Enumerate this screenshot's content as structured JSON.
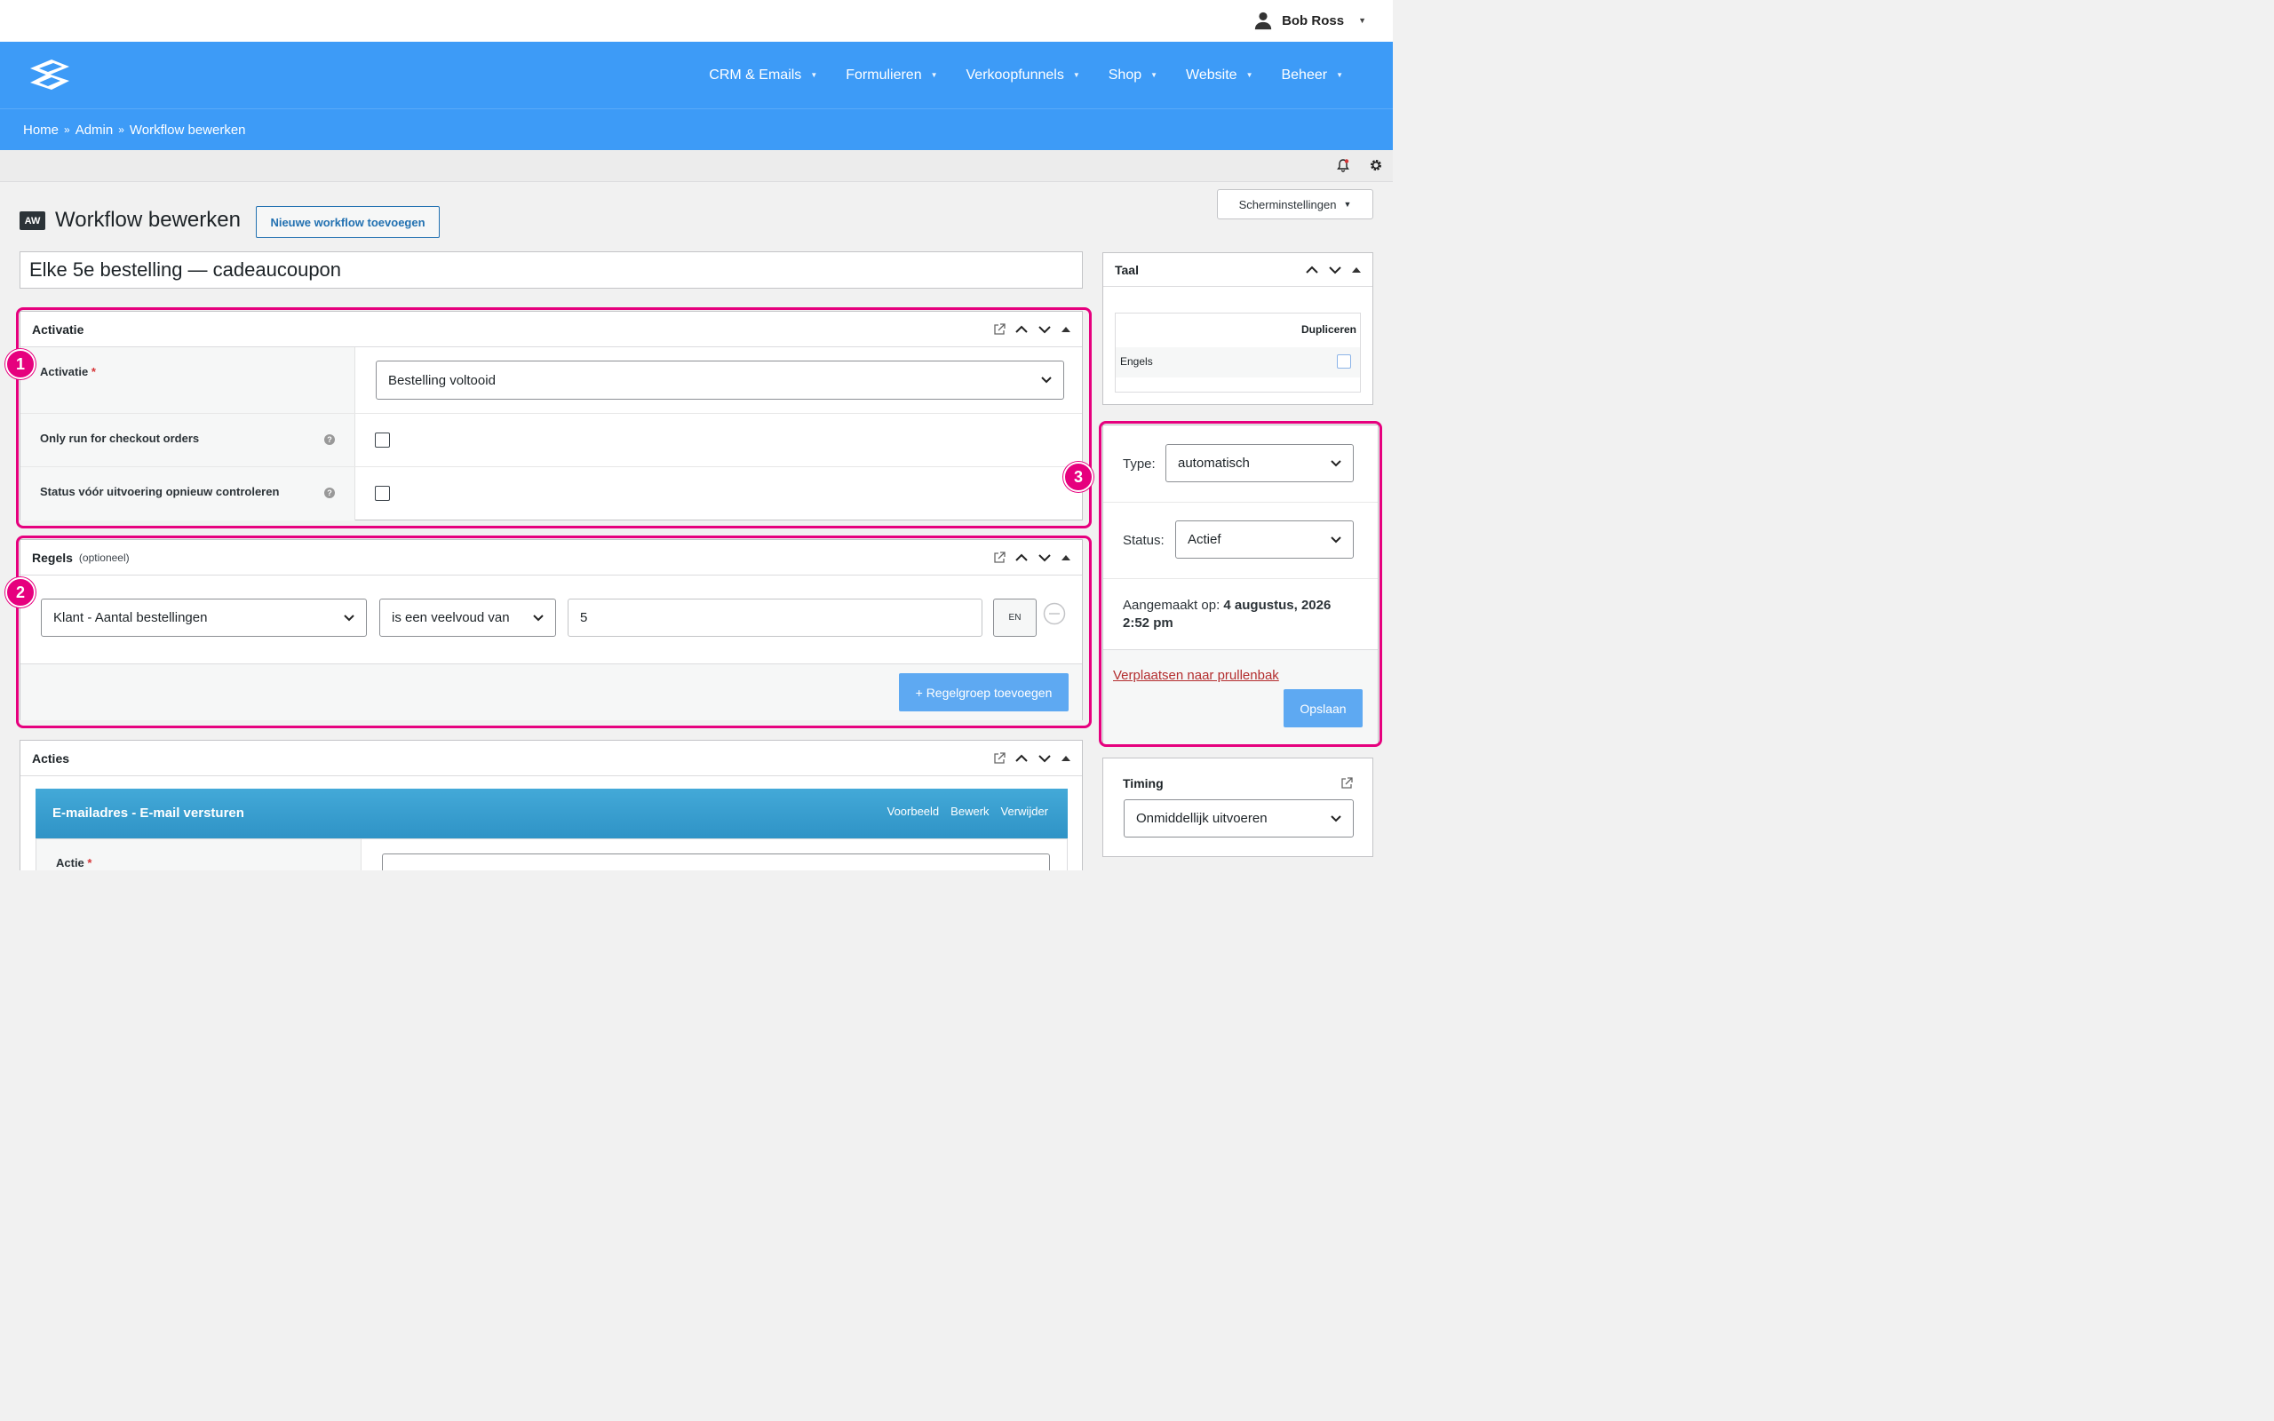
{
  "user": {
    "name": "Bob Ross"
  },
  "nav": {
    "items": [
      "CRM & Emails",
      "Formulieren",
      "Verkoopfunnels",
      "Shop",
      "Website",
      "Beheer"
    ]
  },
  "breadcrumb": [
    "Home",
    "Admin",
    "Workflow bewerken"
  ],
  "breadcrumb_sep": "»",
  "screen_options": "Scherminstellingen",
  "page": {
    "badge": "AW",
    "title": "Workflow bewerken",
    "add_button": "Nieuwe workflow toevoegen",
    "workflow_title": "Elke 5e bestelling — cadeaucoupon"
  },
  "activation": {
    "title": "Activatie",
    "label": "Activatie",
    "required": "*",
    "trigger_value": "Bestelling voltooid",
    "checkout_label": "Only run for checkout orders",
    "recheck_label": "Status vóór uitvoering opnieuw controleren",
    "help": "?"
  },
  "rules": {
    "title": "Regels",
    "subtitle": "(optioneel)",
    "field": "Klant - Aantal bestellingen",
    "operator": "is een veelvoud van",
    "value": "5",
    "and_button": "EN",
    "add_group": "+ Regelgroep toevoegen"
  },
  "actions": {
    "title": "Acties",
    "action_title": "E-mailadres - E-mail versturen",
    "links": [
      "Voorbeeld",
      "Bewerk",
      "Verwijder"
    ],
    "action_label": "Actie",
    "required": "*"
  },
  "language": {
    "title": "Taal",
    "duplicate_header": "Dupliceren",
    "lang": "Engels"
  },
  "publish": {
    "type_label": "Type:",
    "type_value": "automatisch",
    "status_label": "Status:",
    "status_value": "Actief",
    "created_label": "Aangemaakt op:",
    "created_value": "4 augustus, 2026",
    "created_time": "2:52 pm",
    "trash": "Verplaatsen naar prullenbak",
    "save": "Opslaan"
  },
  "timing": {
    "title": "Timing",
    "value": "Onmiddellijk uitvoeren"
  },
  "markers": [
    "1",
    "2",
    "3"
  ],
  "colors": {
    "nav": "#3d9bf7",
    "highlight": "#e6007e",
    "primary_button": "#5ea9f2"
  }
}
